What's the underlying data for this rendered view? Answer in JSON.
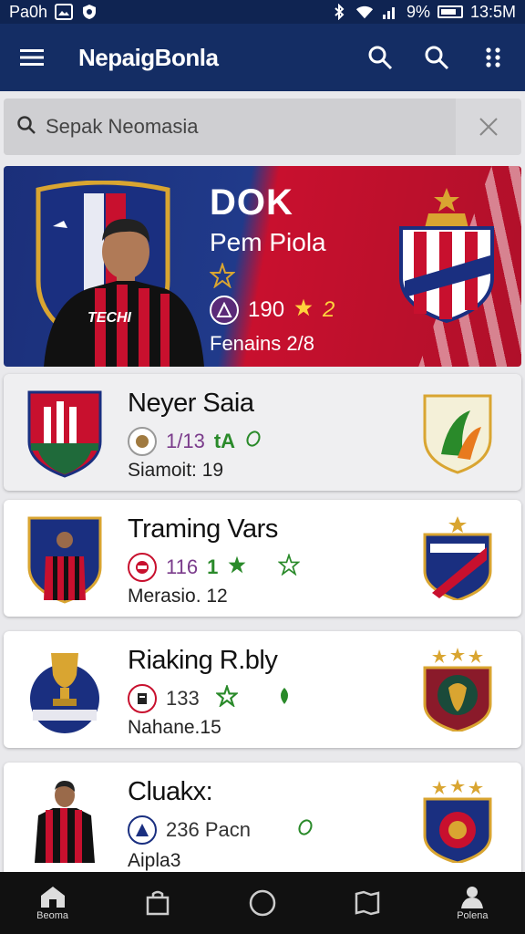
{
  "status_bar": {
    "carrier": "Pa0h",
    "battery": "9%",
    "time": "13:5M"
  },
  "app_bar": {
    "title": "NepaigBonla"
  },
  "search": {
    "placeholder": "Sepak Neomasia"
  },
  "featured": {
    "title": "DOK",
    "subtitle": "Pem Piola",
    "stat_value": "190",
    "stat_value_2": "2",
    "footer": "Fenains 2/8",
    "jersey_text": "TECHI"
  },
  "cards": [
    {
      "name": "Neyer Saia",
      "stat_value": "1/13",
      "stat_value_2": "tA",
      "meta": "Siamoit: 19"
    },
    {
      "name": "Traming Vars",
      "stat_value": "116",
      "stat_value_2": "1",
      "meta": "Merasio. 12"
    },
    {
      "name": "Riaking R.bly",
      "stat_value": "133",
      "stat_value_2": "",
      "meta": "Nahane.15"
    },
    {
      "name": "Cluakx:",
      "stat_value": "236 Pacn",
      "stat_value_2": "",
      "meta": "Aipla3"
    }
  ],
  "bottom_nav": {
    "items": [
      {
        "label": "Beoma",
        "icon": "home-icon"
      },
      {
        "label": "",
        "icon": "shop-icon"
      },
      {
        "label": "",
        "icon": "circle-icon"
      },
      {
        "label": "",
        "icon": "map-icon"
      },
      {
        "label": "Polena",
        "icon": "profile-icon"
      }
    ]
  },
  "colors": {
    "app_bar": "#142d64",
    "status_bar": "#0f2452",
    "hero_blue": "#1b2f7a",
    "hero_red": "#c8102e",
    "accent_green": "#2a8a2a",
    "accent_gold": "#ffd23c"
  }
}
